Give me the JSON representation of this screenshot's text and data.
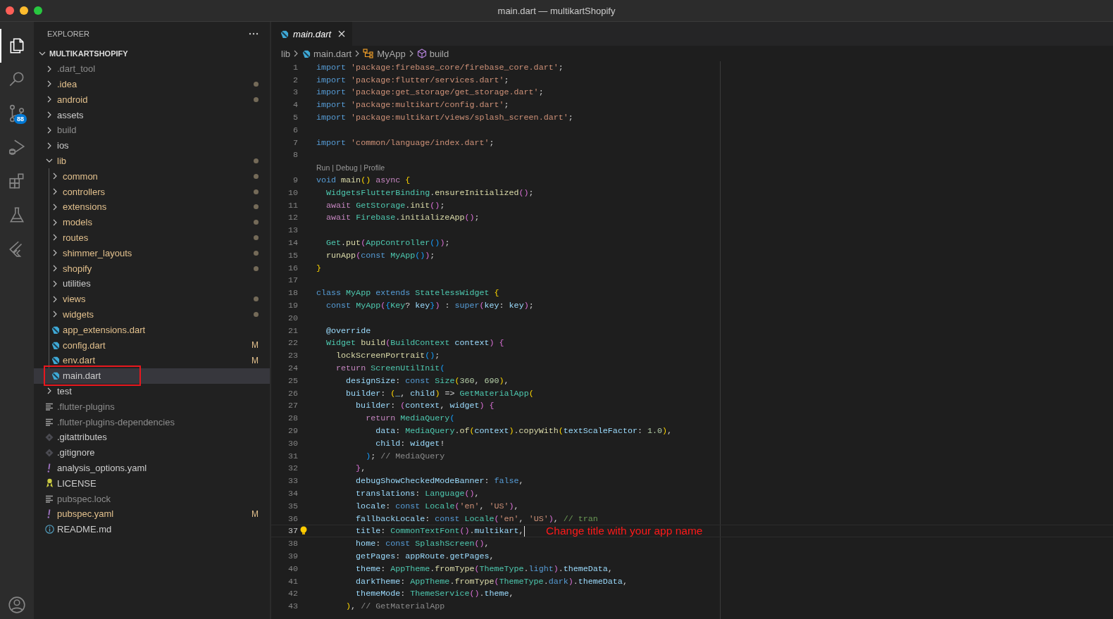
{
  "window": {
    "title": "main.dart — multikartShopify"
  },
  "activity_bar": {
    "items": [
      {
        "kind": "files",
        "selected": true
      },
      {
        "kind": "search",
        "selected": false
      },
      {
        "kind": "source-control",
        "selected": false,
        "badge": "88"
      },
      {
        "kind": "run-debug",
        "selected": false
      },
      {
        "kind": "extensions",
        "selected": false
      },
      {
        "kind": "testing",
        "selected": false
      },
      {
        "kind": "flutter",
        "selected": false
      }
    ],
    "account": {
      "kind": "account"
    }
  },
  "sidebar": {
    "title": "EXPLORER",
    "project": {
      "label": "MULTIKARTSHOPIFY",
      "expanded": true,
      "children": [
        {
          "label": ".dart_tool",
          "kind": "folder",
          "expanded": false,
          "selected": false,
          "color": "#8c8c8c"
        },
        {
          "label": ".idea",
          "kind": "folder",
          "expanded": false,
          "selected": false,
          "color": "#e2c08d",
          "dot": true
        },
        {
          "label": "android",
          "kind": "folder",
          "expanded": false,
          "selected": false,
          "color": "#e2c08d",
          "dot": true
        },
        {
          "label": "assets",
          "kind": "folder",
          "expanded": false,
          "selected": false,
          "color": "#cccccc"
        },
        {
          "label": "build",
          "kind": "folder",
          "expanded": false,
          "selected": false,
          "color": "#8c8c8c"
        },
        {
          "label": "ios",
          "kind": "folder",
          "expanded": false,
          "selected": false,
          "color": "#cccccc"
        },
        {
          "label": "lib",
          "kind": "folder",
          "expanded": true,
          "selected": false,
          "color": "#e2c08d",
          "dot": true,
          "children": [
            {
              "label": "common",
              "kind": "folder",
              "expanded": false,
              "selected": false,
              "color": "#e2c08d",
              "dot": true
            },
            {
              "label": "controllers",
              "kind": "folder",
              "expanded": false,
              "selected": false,
              "color": "#e2c08d",
              "dot": true
            },
            {
              "label": "extensions",
              "kind": "folder",
              "expanded": false,
              "selected": false,
              "color": "#e2c08d",
              "dot": true
            },
            {
              "label": "models",
              "kind": "folder",
              "expanded": false,
              "selected": false,
              "color": "#e2c08d",
              "dot": true
            },
            {
              "label": "routes",
              "kind": "folder",
              "expanded": false,
              "selected": false,
              "color": "#e2c08d",
              "dot": true
            },
            {
              "label": "shimmer_layouts",
              "kind": "folder",
              "expanded": false,
              "selected": false,
              "color": "#e2c08d",
              "dot": true
            },
            {
              "label": "shopify",
              "kind": "folder",
              "expanded": false,
              "selected": false,
              "color": "#e2c08d",
              "dot": true
            },
            {
              "label": "utilities",
              "kind": "folder",
              "expanded": false,
              "selected": false,
              "color": "#cccccc"
            },
            {
              "label": "views",
              "kind": "folder",
              "expanded": false,
              "selected": false,
              "color": "#e2c08d",
              "dot": true
            },
            {
              "label": "widgets",
              "kind": "folder",
              "expanded": false,
              "selected": false,
              "color": "#e2c08d",
              "dot": true
            },
            {
              "label": "app_extensions.dart",
              "kind": "dart",
              "selected": false,
              "color": "#e2c08d"
            },
            {
              "label": "config.dart",
              "kind": "dart",
              "selected": false,
              "color": "#e2c08d",
              "badge": "M"
            },
            {
              "label": "env.dart",
              "kind": "dart",
              "selected": false,
              "color": "#e2c08d",
              "badge": "M"
            },
            {
              "label": "main.dart",
              "kind": "dart",
              "selected": true,
              "color": "#cccccc",
              "highlighted": true
            }
          ]
        },
        {
          "label": "test",
          "kind": "folder",
          "expanded": false,
          "selected": false,
          "color": "#cccccc"
        },
        {
          "label": ".flutter-plugins",
          "kind": "lines",
          "selected": false,
          "color": "#8c8c8c"
        },
        {
          "label": ".flutter-plugins-dependencies",
          "kind": "lines",
          "selected": false,
          "color": "#8c8c8c"
        },
        {
          "label": ".gitattributes",
          "kind": "git",
          "selected": false,
          "color": "#cccccc"
        },
        {
          "label": ".gitignore",
          "kind": "git",
          "selected": false,
          "color": "#cccccc"
        },
        {
          "label": "analysis_options.yaml",
          "kind": "yaml",
          "selected": false,
          "color": "#cccccc"
        },
        {
          "label": "LICENSE",
          "kind": "license",
          "selected": false,
          "color": "#cccccc"
        },
        {
          "label": "pubspec.lock",
          "kind": "lines",
          "selected": false,
          "color": "#8c8c8c"
        },
        {
          "label": "pubspec.yaml",
          "kind": "yaml",
          "selected": false,
          "color": "#e2c08d",
          "badge": "M"
        },
        {
          "label": "README.md",
          "kind": "info",
          "selected": false,
          "color": "#cccccc"
        }
      ]
    }
  },
  "editor": {
    "tabs": [
      {
        "label": "main.dart",
        "kind": "dart",
        "selected": true,
        "preview": true
      }
    ],
    "breadcrumbs": [
      {
        "label": "lib"
      },
      {
        "label": "main.dart",
        "kind": "dart"
      },
      {
        "label": "MyApp",
        "kind": "class"
      },
      {
        "label": "build",
        "kind": "method"
      }
    ],
    "lines": [
      {
        "kind": "code",
        "number": "1",
        "current": false,
        "text": "import 'package:firebase_core/firebase_core.dart';"
      },
      {
        "kind": "code",
        "number": "2",
        "current": false,
        "text": "import 'package:flutter/services.dart';"
      },
      {
        "kind": "code",
        "number": "3",
        "current": false,
        "text": "import 'package:get_storage/get_storage.dart';"
      },
      {
        "kind": "code",
        "number": "4",
        "current": false,
        "text": "import 'package:multikart/config.dart';"
      },
      {
        "kind": "code",
        "number": "5",
        "current": false,
        "text": "import 'package:multikart/views/splash_screen.dart';"
      },
      {
        "kind": "code",
        "number": "6",
        "current": false
      },
      {
        "kind": "code",
        "number": "7",
        "current": false,
        "text": "import 'common/language/index.dart';"
      },
      {
        "kind": "code",
        "number": "8",
        "current": false
      },
      {
        "kind": "codelens",
        "text": "Run | Debug | Profile"
      },
      {
        "kind": "code",
        "number": "9",
        "current": false,
        "text": "void main() async {"
      },
      {
        "kind": "code",
        "number": "10",
        "current": false,
        "text": "  WidgetsFlutterBinding.ensureInitialized();"
      },
      {
        "kind": "code",
        "number": "11",
        "current": false,
        "text": "  await GetStorage.init();"
      },
      {
        "kind": "code",
        "number": "12",
        "current": false,
        "text": "  await Firebase.initializeApp();"
      },
      {
        "kind": "code",
        "number": "13",
        "current": false
      },
      {
        "kind": "code",
        "number": "14",
        "current": false,
        "text": "  Get.put(AppController());"
      },
      {
        "kind": "code",
        "number": "15",
        "current": false,
        "text": "  runApp(const MyApp());"
      },
      {
        "kind": "code",
        "number": "16",
        "current": false,
        "text": "}"
      },
      {
        "kind": "code",
        "number": "17",
        "current": false
      },
      {
        "kind": "code",
        "number": "18",
        "current": false,
        "text": "class MyApp extends StatelessWidget {"
      },
      {
        "kind": "code",
        "number": "19",
        "current": false,
        "text": "  const MyApp({Key? key}) : super(key: key);"
      },
      {
        "kind": "code",
        "number": "20",
        "current": false
      },
      {
        "kind": "code",
        "number": "21",
        "current": false,
        "text": "  @override"
      },
      {
        "kind": "code",
        "number": "22",
        "current": false,
        "text": "  Widget build(BuildContext context) {"
      },
      {
        "kind": "code",
        "number": "23",
        "current": false,
        "text": "    lockScreenPortrait();"
      },
      {
        "kind": "code",
        "number": "24",
        "current": false,
        "text": "    return ScreenUtilInit("
      },
      {
        "kind": "code",
        "number": "25",
        "current": false,
        "text": "      designSize: const Size(360, 690),"
      },
      {
        "kind": "code",
        "number": "26",
        "current": false,
        "text": "      builder: (_, child) => GetMaterialApp("
      },
      {
        "kind": "code",
        "number": "27",
        "current": false,
        "text": "        builder: (context, widget) {"
      },
      {
        "kind": "code",
        "number": "28",
        "current": false,
        "text": "          return MediaQuery("
      },
      {
        "kind": "code",
        "number": "29",
        "current": false,
        "text": "            data: MediaQuery.of(context).copyWith(textScaleFactor: 1.0),"
      },
      {
        "kind": "code",
        "number": "30",
        "current": false,
        "text": "            child: widget!"
      },
      {
        "kind": "code",
        "number": "31",
        "current": false,
        "text": "          );",
        "hint": "// MediaQuery"
      },
      {
        "kind": "code",
        "number": "32",
        "current": false,
        "text": "        },"
      },
      {
        "kind": "code",
        "number": "33",
        "current": false,
        "text": "        debugShowCheckedModeBanner: false,"
      },
      {
        "kind": "code",
        "number": "34",
        "current": false,
        "text": "        translations: Language(),"
      },
      {
        "kind": "code",
        "number": "35",
        "current": false,
        "text": "        locale: const Locale('en', 'US'),"
      },
      {
        "kind": "code",
        "number": "36",
        "current": false,
        "text": "        fallbackLocale: const Locale('en', 'US'), // tran"
      },
      {
        "kind": "code",
        "number": "37",
        "current": true,
        "lightbulb": true,
        "cursor": true,
        "note": "Change title with your app name",
        "text": "        title: CommonTextFont().multikart,"
      },
      {
        "kind": "code",
        "number": "38",
        "current": false,
        "text": "        home: const SplashScreen(),"
      },
      {
        "kind": "code",
        "number": "39",
        "current": false,
        "text": "        getPages: appRoute.getPages,"
      },
      {
        "kind": "code",
        "number": "40",
        "current": false,
        "text": "        theme: AppTheme.fromType(ThemeType.light).themeData,"
      },
      {
        "kind": "code",
        "number": "41",
        "current": false,
        "text": "        darkTheme: AppTheme.fromType(ThemeType.dark).themeData,"
      },
      {
        "kind": "code",
        "number": "42",
        "current": false,
        "text": "        themeMode: ThemeService().theme,"
      },
      {
        "kind": "code",
        "number": "43",
        "current": false,
        "text": "      ),",
        "hint": "// GetMaterialApp"
      }
    ]
  }
}
